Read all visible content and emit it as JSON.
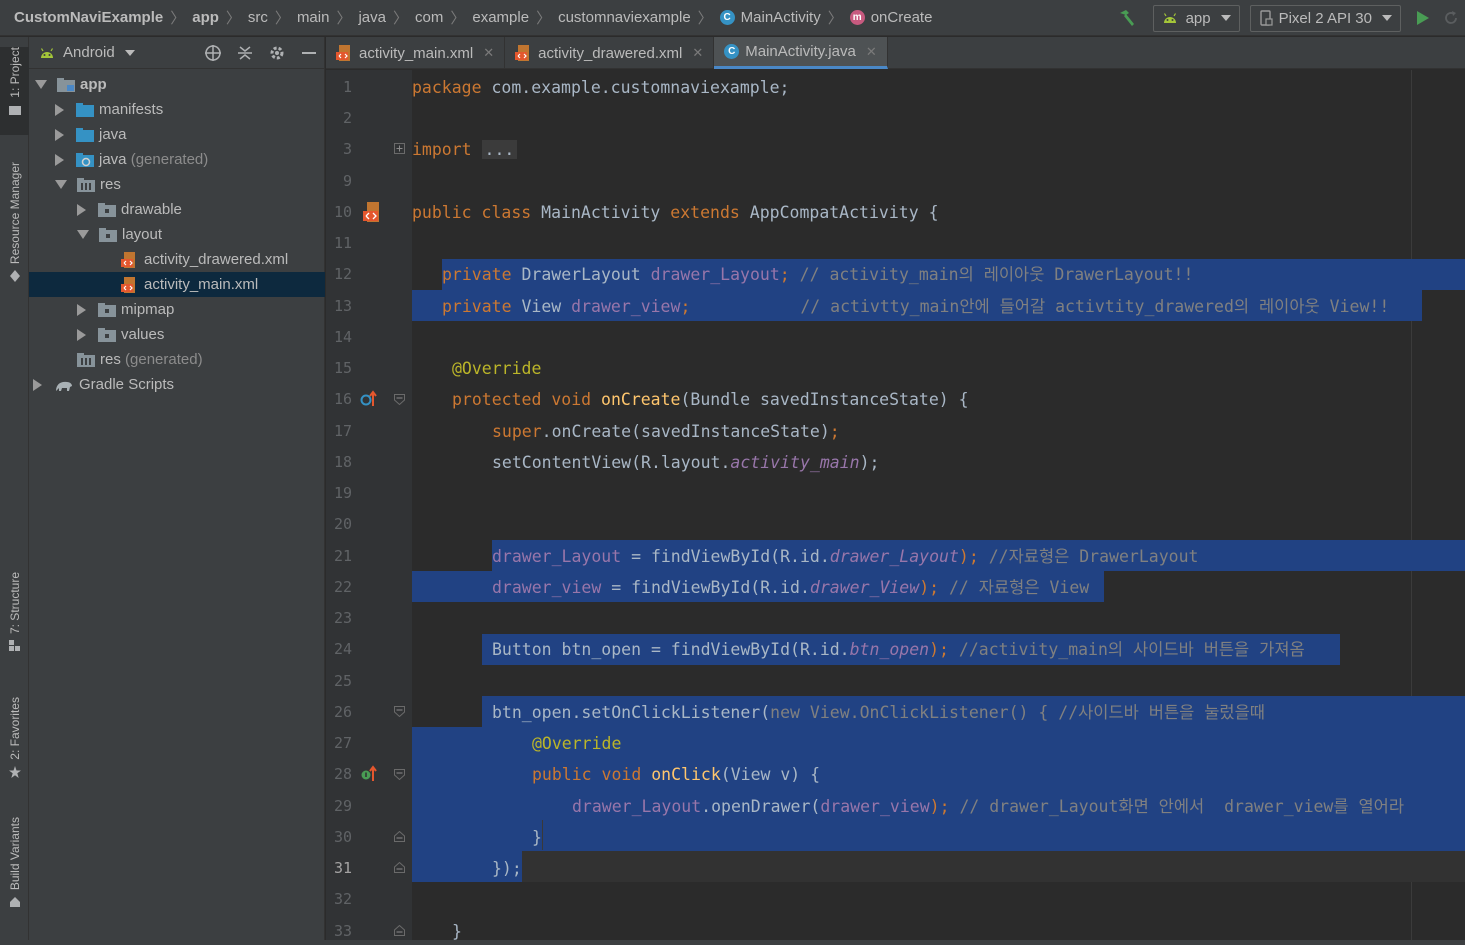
{
  "navbar": {
    "crumbs": [
      "CustomNaviExample",
      "app",
      "src",
      "main",
      "java",
      "com",
      "example",
      "customnaviexample",
      "MainActivity",
      "onCreate"
    ],
    "run_config": "app",
    "device": "Pixel 2 API 30"
  },
  "left_strip": {
    "tabs": [
      "1: Project",
      "Resource Manager",
      "7: Structure",
      "2: Favorites",
      "Build Variants"
    ]
  },
  "project": {
    "view_mode": "Android",
    "tree": [
      {
        "label": "app",
        "extra": ""
      },
      {
        "label": "manifests",
        "extra": ""
      },
      {
        "label": "java",
        "extra": ""
      },
      {
        "label": "java",
        "extra": "(generated)"
      },
      {
        "label": "res",
        "extra": ""
      },
      {
        "label": "drawable",
        "extra": ""
      },
      {
        "label": "layout",
        "extra": ""
      },
      {
        "label": "activity_drawered.xml",
        "extra": ""
      },
      {
        "label": "activity_main.xml",
        "extra": ""
      },
      {
        "label": "mipmap",
        "extra": ""
      },
      {
        "label": "values",
        "extra": ""
      },
      {
        "label": "res",
        "extra": "(generated)"
      },
      {
        "label": "Gradle Scripts",
        "extra": ""
      }
    ]
  },
  "tabs": [
    "activity_main.xml",
    "activity_drawered.xml",
    "MainActivity.java"
  ],
  "editor": {
    "line_numbers": [
      "1",
      "2",
      "3",
      "9",
      "10",
      "11",
      "12",
      "13",
      "14",
      "15",
      "16",
      "17",
      "18",
      "19",
      "20",
      "21",
      "22",
      "23",
      "24",
      "25",
      "26",
      "27",
      "28",
      "29",
      "30",
      "31",
      "32",
      "33"
    ],
    "current_line": "31",
    "tokens": {
      "l1": [
        "package",
        " com.example.customnaviexample;"
      ],
      "l3": [
        "import",
        "..."
      ],
      "l10": [
        "public class",
        " MainActivity ",
        "extends",
        " AppCompatActivity {"
      ],
      "l12": [
        "private",
        " DrawerLayout ",
        "drawer_Layout",
        ";",
        " // activity_main의 레이아웃 DrawerLayout!!"
      ],
      "l13": [
        "private",
        " View ",
        "drawer_view",
        ";",
        "// activtty_main안에 들어갈 activtity_drawered의 레이아웃 View!!"
      ],
      "l15": [
        "@Override"
      ],
      "l16": [
        "protected void",
        " onCreate",
        "(Bundle savedInstanceState) {"
      ],
      "l17": [
        "super",
        ".onCreate(savedInstanceState)",
        ";"
      ],
      "l18": [
        "setContentView(R.layout.",
        "activity_main",
        ");"
      ],
      "l21": [
        "drawer_Layout",
        " = findViewById(R.id.",
        "drawer_Layout",
        ");",
        " //자료형은 DrawerLayout"
      ],
      "l22": [
        "drawer_view",
        " = findViewById(R.id.",
        "drawer_View",
        ");",
        " // 자료형은 View"
      ],
      "l24": [
        "Button btn_open = findViewById(R.id.",
        "btn_open",
        ");",
        " //activity_main의 사이드바 버튼을 가져옴"
      ],
      "l26": [
        "btn_open.setOnClickListener(",
        "new",
        " View.OnClickListener() {",
        " //사이드바 버튼을 눌렀을때"
      ],
      "l27": [
        "@Override"
      ],
      "l28": [
        "public void",
        " onClick",
        "(View v) {"
      ],
      "l29": [
        "drawer_Layout",
        ".openDrawer(",
        "drawer_view",
        ");",
        " // drawer_Layout화면 안에서  drawer_view를 열어라"
      ],
      "l30": [
        "}"
      ],
      "l31": [
        "});"
      ],
      "l33": [
        "}"
      ]
    }
  },
  "colors": {
    "selection": "#214283",
    "keyword": "#cc7832",
    "field": "#9876aa",
    "comment": "#808080",
    "annotation": "#bbb529",
    "method": "#ffc66d",
    "text": "#a9b7c6"
  }
}
